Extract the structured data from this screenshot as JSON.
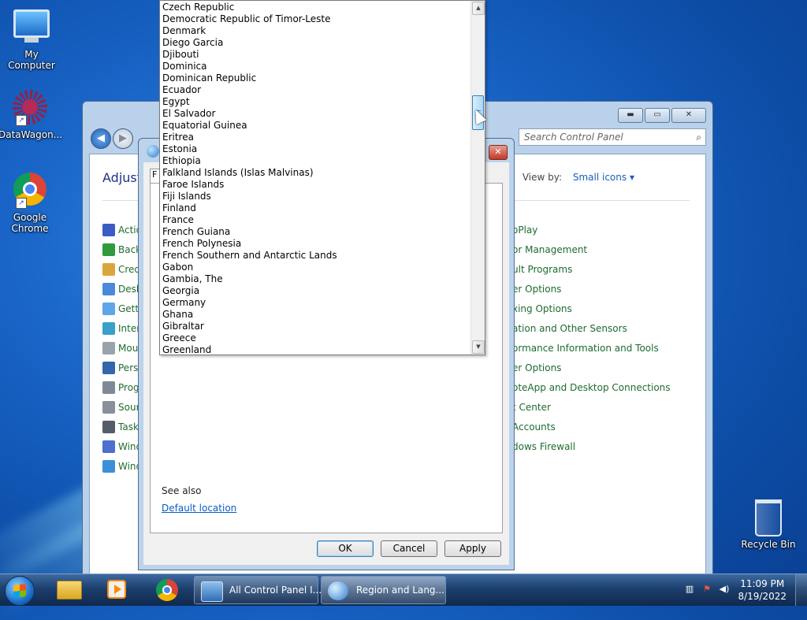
{
  "desktop": {
    "icons": [
      {
        "label": "My Computer",
        "icon": "computer-icon"
      },
      {
        "label": "DataWagon...",
        "icon": "datawagon-icon"
      },
      {
        "label": "Google Chrome",
        "icon": "chrome-icon"
      },
      {
        "label": "Recycle Bin",
        "icon": "recycle-bin-icon"
      }
    ]
  },
  "control_panel": {
    "search_placeholder": "Search Control Panel",
    "heading": "Adjust",
    "view_by_label": "View by:",
    "view_by_value": "Small icons",
    "left_items": [
      "Actio",
      "Back",
      "Cred",
      "Desk",
      "Getti",
      "Inter",
      "Mou",
      "Perso",
      "Prog",
      "Soun",
      "Task",
      "Wind",
      "Wind"
    ],
    "right_items": [
      "oPlay",
      "or Management",
      "ult Programs",
      "er Options",
      "xing Options",
      "ation and Other Sensors",
      "ormance Information and Tools",
      "er Options",
      "oteApp and Desktop Connections",
      "t Center",
      "Accounts",
      "dows Firewall"
    ]
  },
  "region_dialog": {
    "tab_letter": "F",
    "see_also": "See also",
    "default_location_link": "Default location",
    "buttons": {
      "ok": "OK",
      "cancel": "Cancel",
      "apply": "Apply"
    }
  },
  "dropdown": {
    "items": [
      "Czech Republic",
      "Democratic Republic of Timor-Leste",
      "Denmark",
      "Diego Garcia",
      "Djibouti",
      "Dominica",
      "Dominican Republic",
      "Ecuador",
      "Egypt",
      "El Salvador",
      "Equatorial Guinea",
      "Eritrea",
      "Estonia",
      "Ethiopia",
      "Falkland Islands (Islas Malvinas)",
      "Faroe Islands",
      "Fiji Islands",
      "Finland",
      "France",
      "French Guiana",
      "French Polynesia",
      "French Southern and Antarctic Lands",
      "Gabon",
      "Gambia, The",
      "Georgia",
      "Germany",
      "Ghana",
      "Gibraltar",
      "Greece",
      "Greenland"
    ],
    "scroll_arrows": {
      "up": "▲",
      "down": "▼"
    }
  },
  "taskbar": {
    "tasks": [
      {
        "label": "All Control Panel I...",
        "icon": "control-panel-icon"
      },
      {
        "label": "Region and Lang...",
        "icon": "globe-icon"
      }
    ],
    "clock": {
      "time": "11:09 PM",
      "date": "8/19/2022"
    },
    "tray_icons": [
      "network-icon",
      "action-center-icon",
      "volume-icon"
    ]
  }
}
